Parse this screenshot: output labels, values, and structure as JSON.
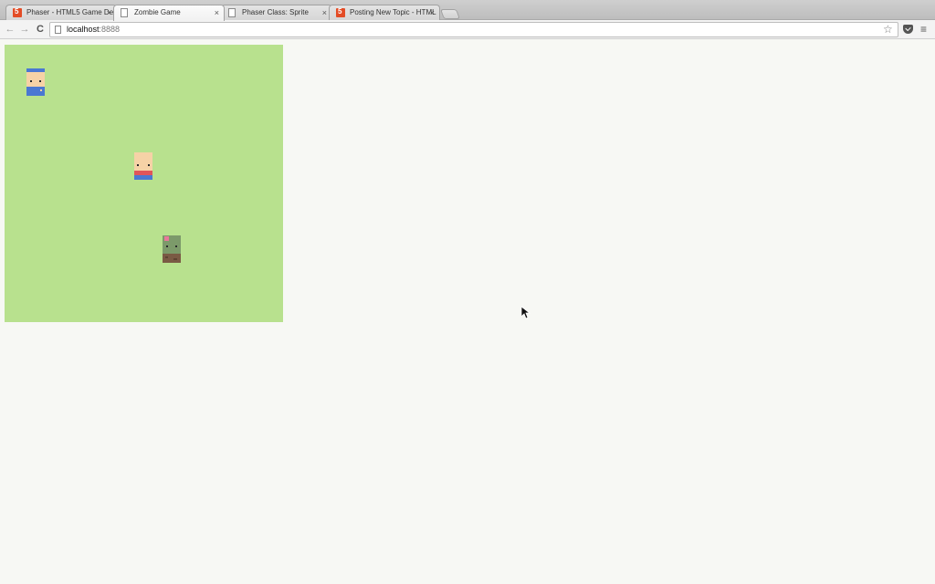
{
  "browser": {
    "tabs": [
      {
        "label": "Phaser - HTML5 Game De",
        "icon": "html5-icon",
        "active": false
      },
      {
        "label": "Zombie Game",
        "icon": "document-icon",
        "active": true
      },
      {
        "label": "Phaser Class: Sprite",
        "icon": "document-icon",
        "active": false
      },
      {
        "label": "Posting New Topic - HTML",
        "icon": "html5-icon",
        "active": false
      }
    ],
    "tab_close_glyph": "×",
    "address": {
      "host": "localhost",
      "port": ":8888"
    },
    "nav": {
      "back": "←",
      "forward": "→",
      "reload": "C"
    },
    "star_glyph": "☆",
    "menu_glyph": "≡"
  },
  "game": {
    "background_color": "#b8e18e",
    "sprites": [
      {
        "name": "player-blue",
        "kind": "human"
      },
      {
        "name": "player-red",
        "kind": "human"
      },
      {
        "name": "zombie",
        "kind": "zombie"
      }
    ]
  },
  "colors": {
    "skin": "#f6d2a6",
    "blue": "#4a78d2",
    "red": "#e0555a",
    "zombie_skin": "#7c9a6a",
    "zombie_pants": "#7a5a44",
    "zombie_wound": "#e8789a"
  }
}
